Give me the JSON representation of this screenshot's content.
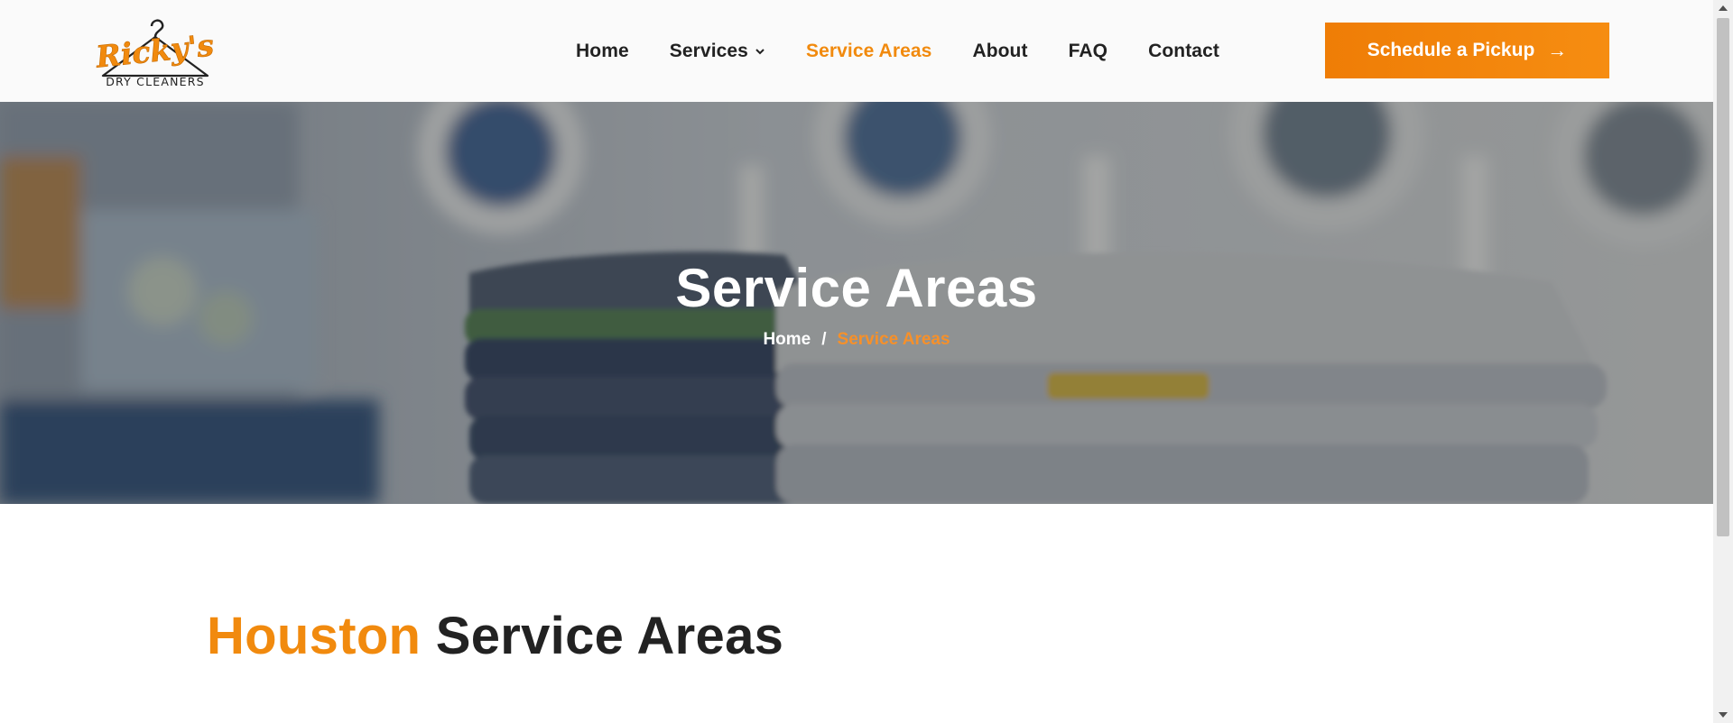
{
  "brand": {
    "name": "Ricky's",
    "tagline": "DRY CLEANERS",
    "accent": "#f18a0e"
  },
  "nav": {
    "items": [
      {
        "label": "Home",
        "active": false,
        "dropdown": false
      },
      {
        "label": "Services",
        "active": false,
        "dropdown": true
      },
      {
        "label": "Service Areas",
        "active": true,
        "dropdown": false
      },
      {
        "label": "About",
        "active": false,
        "dropdown": false
      },
      {
        "label": "FAQ",
        "active": false,
        "dropdown": false
      },
      {
        "label": "Contact",
        "active": false,
        "dropdown": false
      }
    ],
    "cta_label": "Schedule a Pickup",
    "cta_icon": "arrow-right-icon"
  },
  "hero": {
    "title": "Service Areas",
    "breadcrumb": {
      "home": "Home",
      "separator": "/",
      "current": "Service Areas"
    }
  },
  "section": {
    "title_accent": "Houston",
    "title_rest": "Service Areas"
  }
}
